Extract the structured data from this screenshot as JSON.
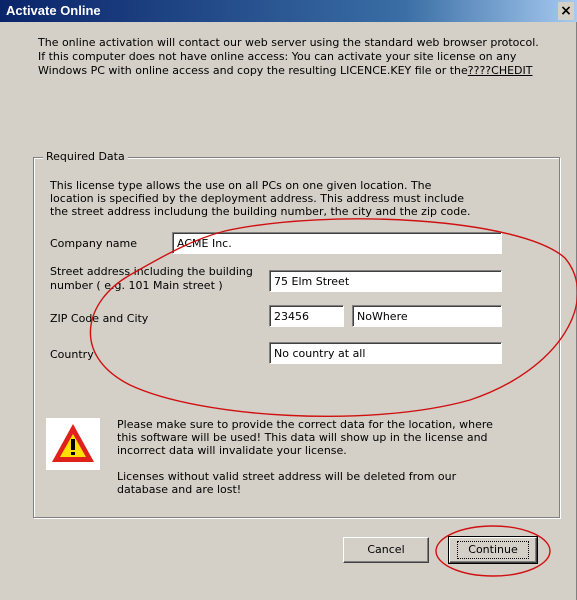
{
  "window": {
    "title": "Activate Online",
    "close_glyph": "×"
  },
  "intro": {
    "line1": "The online activation will contact our web server using the standard web browser protocol.",
    "line2": "If this computer does not have online access: You can activate your site license on any",
    "line3_main": "Windows PC with online access  and copy the resulting LICENCE.KEY file or the",
    "line3_tail": "????CHEDIT"
  },
  "required": {
    "label": "Required Data",
    "desc1": "This license type allows the use on all PCs on one given location. The",
    "desc2": "location is specified by the deployment address. This address must include",
    "desc3": "the street address includung the building number, the city and the zip code."
  },
  "fields": {
    "company_label": "Company name",
    "company_value": "ACME Inc.",
    "street_label_1": "Street address including the building",
    "street_label_2": "number ( e.g. 101 Main street )",
    "street_value": "75 Elm Street",
    "zip_label": "ZIP Code and City",
    "zip_value": "23456",
    "city_value": "NoWhere",
    "country_label": "Country",
    "country_value": "No country at all"
  },
  "warning": {
    "icon": "warning-triangle-icon",
    "line1": "Please make sure to provide the correct data for the location, where",
    "line2": "this software will be used! This data will show up in the license and",
    "line3": "incorrect data will invalidate your license.",
    "line4": "Licenses without valid street address will be deleted from our",
    "line5": "database and are lost!"
  },
  "buttons": {
    "cancel": "Cancel",
    "continue": "Continue"
  },
  "colors": {
    "dialog_bg": "#d4d0c8",
    "title_bar": "#0a246a",
    "annotation": "#d01010",
    "warning_red": "#e0201a",
    "warning_yellow": "#ffe000"
  }
}
